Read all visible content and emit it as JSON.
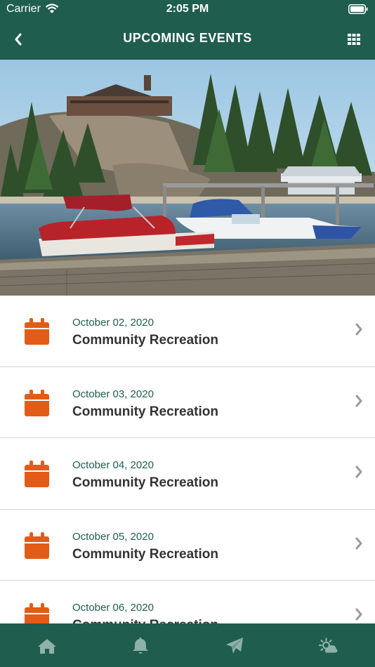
{
  "status_bar": {
    "carrier": "Carrier",
    "time": "2:05 PM"
  },
  "header": {
    "title": "UPCOMING EVENTS",
    "back_icon": "chevron-left-icon",
    "menu_icon": "grid-icon"
  },
  "events": [
    {
      "date": "October 02, 2020",
      "name": "Community Recreation"
    },
    {
      "date": "October 03, 2020",
      "name": "Community Recreation"
    },
    {
      "date": "October 04, 2020",
      "name": "Community Recreation"
    },
    {
      "date": "October 05, 2020",
      "name": "Community Recreation"
    },
    {
      "date": "October 06, 2020",
      "name": "Community Recreation"
    }
  ],
  "tabs": [
    "home-icon",
    "bell-icon",
    "paper-plane-icon",
    "weather-icon"
  ],
  "colors": {
    "primary": "#1f5d4f",
    "accent": "#e35c17",
    "text": "#333333",
    "divider": "#d6d6d6"
  }
}
